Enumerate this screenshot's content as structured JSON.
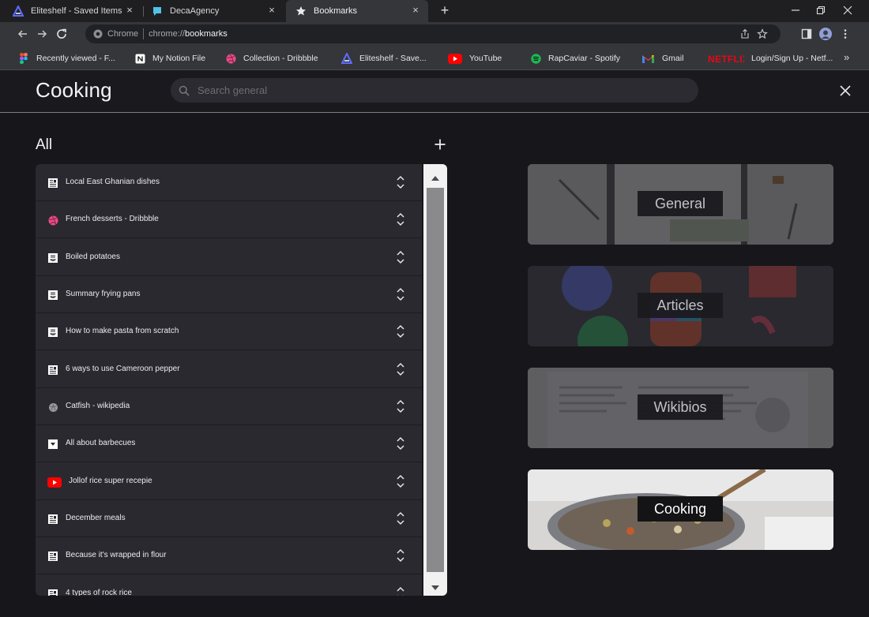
{
  "browser": {
    "tabs": [
      {
        "title": "Eliteshelf - Saved Items",
        "icon": "eliteshelf-icon",
        "active": false
      },
      {
        "title": "DecaAgency",
        "icon": "decaagency-icon",
        "active": false
      },
      {
        "title": "Bookmarks",
        "icon": "star-icon",
        "active": true
      }
    ],
    "address_bar": {
      "chip": "Chrome",
      "url_scheme": "chrome://",
      "url_host": "bookmarks"
    },
    "bookmarks": [
      {
        "label": "Recently viewed - F...",
        "icon": "figma-icon"
      },
      {
        "label": "My Notion File",
        "icon": "notion-icon"
      },
      {
        "label": "Collection - Dribbble",
        "icon": "dribbble-icon"
      },
      {
        "label": "Eliteshelf - Save...",
        "icon": "eliteshelf-icon"
      },
      {
        "label": "YouTube",
        "icon": "youtube-icon"
      },
      {
        "label": "RapCaviar - Spotify",
        "icon": "spotify-icon"
      },
      {
        "label": "Gmail",
        "icon": "gmail-icon"
      },
      {
        "label": "Login/Sign Up - Netf...",
        "icon": "netflix-icon"
      }
    ]
  },
  "app": {
    "title": "Cooking",
    "search": {
      "placeholder": "Search general",
      "value": ""
    },
    "section_title": "All",
    "items": [
      {
        "label": "Local East Ghanian dishes",
        "icon": "page-icon"
      },
      {
        "label": "French desserts - Dribbble",
        "icon": "dribbble-icon"
      },
      {
        "label": "Boiled potatoes",
        "icon": "recipe-icon"
      },
      {
        "label": "Summary frying pans",
        "icon": "recipe-icon"
      },
      {
        "label": "How to make pasta from scratch",
        "icon": "recipe-icon"
      },
      {
        "label": "6 ways to use Cameroon pepper",
        "icon": "page-icon"
      },
      {
        "label": "Catfish - wikipedia",
        "icon": "wikipedia-icon"
      },
      {
        "label": "All about barbecues",
        "icon": "dropdown-page-icon"
      },
      {
        "label": "Jollof rice super recepie",
        "icon": "youtube-icon"
      },
      {
        "label": "December meals",
        "icon": "page-icon"
      },
      {
        "label": "Because it's wrapped in flour",
        "icon": "page-icon"
      },
      {
        "label": "4 types of rock rice",
        "icon": "page-icon"
      }
    ],
    "categories": [
      {
        "label": "General",
        "active": false
      },
      {
        "label": "Articles",
        "active": false
      },
      {
        "label": "Wikibios",
        "active": false
      },
      {
        "label": "Cooking",
        "active": true
      }
    ]
  },
  "colors": {
    "background": "#17161b",
    "list_bg": "#2a2930",
    "accent_red": "#e50914",
    "dribbble_pink": "#ea4c89",
    "spotify_green": "#1db954"
  }
}
